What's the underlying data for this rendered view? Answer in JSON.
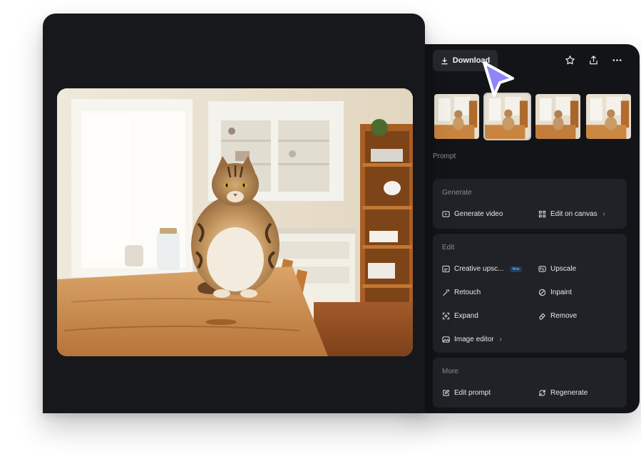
{
  "toolbar": {
    "download_label": "Download",
    "icons": [
      "download-icon",
      "star-icon",
      "share-icon",
      "more-icon"
    ]
  },
  "prompt": {
    "label": "Prompt"
  },
  "generate": {
    "title": "Generate",
    "items": [
      {
        "label": "Generate video",
        "icon": "video-icon"
      },
      {
        "label": "Edit on canvas",
        "icon": "canvas-icon",
        "chevron": "›"
      }
    ]
  },
  "edit": {
    "title": "Edit",
    "items": [
      {
        "label": "Creative upsc...",
        "icon": "creative-upscale-icon",
        "badge": "New"
      },
      {
        "label": "Upscale",
        "icon": "upscale-icon"
      },
      {
        "label": "Retouch",
        "icon": "retouch-icon"
      },
      {
        "label": "Inpaint",
        "icon": "inpaint-icon"
      },
      {
        "label": "Expand",
        "icon": "expand-icon"
      },
      {
        "label": "Remove",
        "icon": "remove-icon"
      },
      {
        "label": "Image editor",
        "icon": "image-editor-icon",
        "chevron": "›"
      }
    ]
  },
  "more": {
    "title": "More",
    "items": [
      {
        "label": "Edit prompt",
        "icon": "edit-prompt-icon"
      },
      {
        "label": "Regenerate",
        "icon": "regenerate-icon"
      }
    ]
  },
  "colors": {
    "panel_bg": "#17181c",
    "card_bg": "#202227",
    "accent_cursor": "#8e86f7"
  }
}
